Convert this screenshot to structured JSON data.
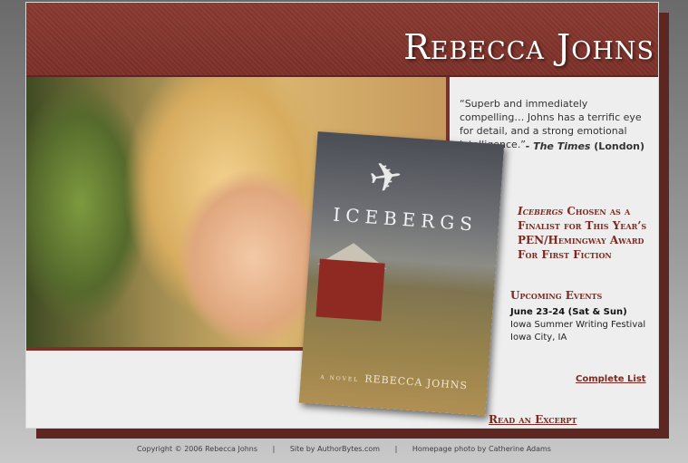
{
  "header": {
    "title": "Rebecca Johns"
  },
  "quote": {
    "text": "“Superb and immediately compelling… Johns has a terrific eye for detail, and a strong emotional intelligence.”",
    "dash": "- ",
    "publication": "The Times",
    "location": " (London)"
  },
  "book": {
    "title": "ICEBERGS",
    "novel_label": "A NOVEL",
    "author": "REBECCA JOHNS"
  },
  "news": {
    "title_italic": "Icebergs",
    "rest": " Chosen as a Finalist for This Year’s PEN/Hemingway Award For First Fiction"
  },
  "events": {
    "heading": "Upcoming Events",
    "items": [
      {
        "date": "June 23-24 (Sat & Sun)",
        "name": "Iowa Summer Writing Festival",
        "place": "Iowa City, IA"
      }
    ],
    "complete_list": "Complete List"
  },
  "links": {
    "excerpt": "Read an Excerpt"
  },
  "footer": {
    "copyright": "Copyright © 2006 Rebecca Johns",
    "site_by": "Site by AuthorBytes.com",
    "photo_credit": "Homepage photo by Catherine Adams",
    "separator": "|"
  },
  "colors": {
    "brand": "#7c3129",
    "accent": "#7a2a22",
    "card": "#eeeeee"
  }
}
